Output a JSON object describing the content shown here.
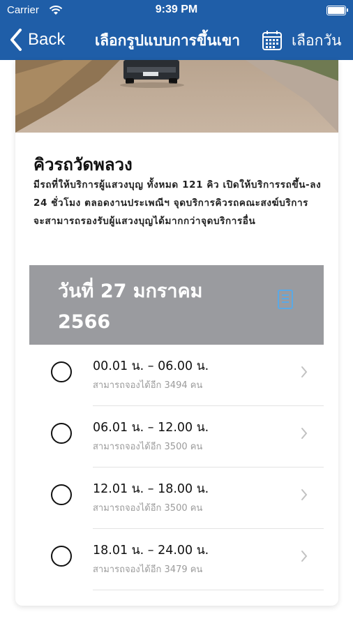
{
  "status_bar": {
    "carrier": "Carrier",
    "time": "9:39 PM"
  },
  "nav": {
    "back_label": "Back",
    "title": "เลือกรูปแบบการขึ้นเขา",
    "date_picker_label": "เลือกวัน"
  },
  "queue": {
    "title": "คิวรถวัดพลวง",
    "description": "มีรถที่ให้บริการผู้แสวงบุญ ทั้งหมด 121 คิว  เปิดให้บริการรถขึ้น-ลง 24 ชั่วโมง ตลอดงานประเพณีฯ จุดบริการคิวรถคณะสงฆ์บริการ จะสามารถรองรับผู้แสวงบุญได้มากกว่าจุดบริการอื่น"
  },
  "date_band": {
    "date": "วันที่ 27 มกราคม 2566"
  },
  "slots": [
    {
      "time": "00.01 น. – 06.00 น.",
      "availability": "สามารถจองได้อีก 3494 คน"
    },
    {
      "time": "06.01 น. – 12.00 น.",
      "availability": "สามารถจองได้อีก 3500 คน"
    },
    {
      "time": "12.01 น. – 18.00 น.",
      "availability": "สามารถจองได้อีก 3500 คน"
    },
    {
      "time": "18.01 น. – 24.00 น.",
      "availability": "สามารถจองได้อีก 3479 คน"
    }
  ],
  "icons": {
    "back": "chevron-left-icon",
    "calendar": "calendar-icon",
    "date_doc": "document-icon",
    "slot_arrow": "chevron-right-icon"
  },
  "colors": {
    "nav_bar": "#1f5ea8",
    "date_band": "#9a9b9f",
    "doc_icon": "#5aa9e6"
  }
}
